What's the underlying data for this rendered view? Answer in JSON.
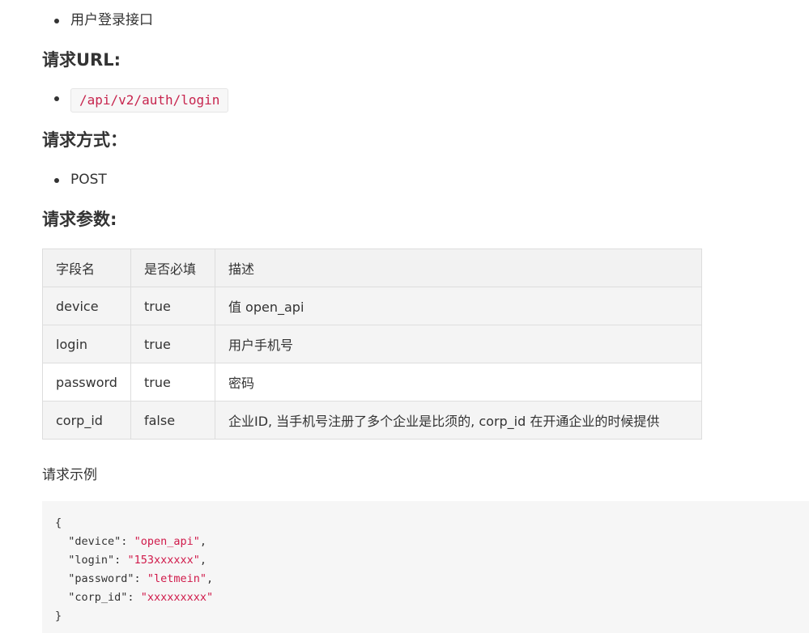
{
  "intro_bullet": "用户登录接口",
  "url_section": {
    "heading": "请求URL:",
    "url": "/api/v2/auth/login"
  },
  "method_section": {
    "heading": "请求方式：",
    "method": "POST"
  },
  "params_section": {
    "heading": "请求参数:",
    "columns": [
      "字段名",
      "是否必填",
      "描述"
    ],
    "rows": [
      {
        "field": "device",
        "required": "true",
        "desc": "值 open_api"
      },
      {
        "field": "login",
        "required": "true",
        "desc": "用户手机号"
      },
      {
        "field": "password",
        "required": "true",
        "desc": "密码"
      },
      {
        "field": "corp_id",
        "required": "false",
        "desc": "企业ID, 当手机号注册了多个企业是比须的, corp_id 在开通企业的时候提供"
      }
    ]
  },
  "example_section": {
    "label": "请求示例",
    "open_brace": "{",
    "close_brace": "}",
    "lines": [
      {
        "key": "\"device\"",
        "value": "\"open_api\"",
        "sep": ","
      },
      {
        "key": "\"login\"",
        "value": "\"153xxxxxx\"",
        "sep": ","
      },
      {
        "key": "\"password\"",
        "value": "\"letmein\"",
        "sep": ","
      },
      {
        "key": "\"corp_id\"",
        "value": "\"xxxxxxxxx\"",
        "sep": ""
      }
    ]
  }
}
